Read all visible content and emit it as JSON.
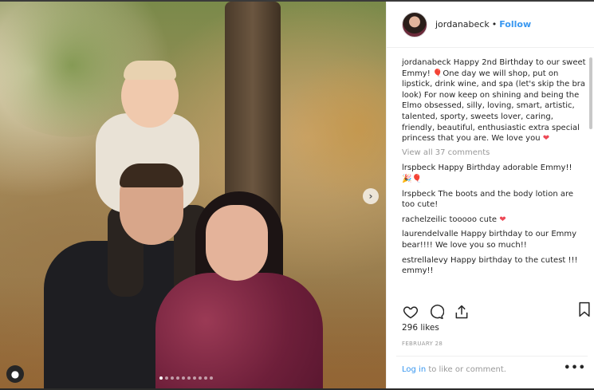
{
  "post": {
    "author": "jordanabeck",
    "follow_label": "Follow",
    "separator": "•"
  },
  "caption": {
    "user": "jordanabeck",
    "text": "Happy 2nd Birthday to our sweet Emmy! ",
    "text2": "One day we will shop, put on lipstick, drink wine, and spa (let's skip the bra look) For now keep on shining and being the Elmo obsessed, silly, loving, smart, artistic, talented, sporty, sweets lover, caring, friendly, beautiful, enthusiastic extra special princess that you are. We love you "
  },
  "view_all_comments": "View all 37 comments",
  "comments": [
    {
      "user": "lrspbeck",
      "text": "Happy Birthday adorable Emmy!!"
    },
    {
      "user": "lrspbeck",
      "text": "The boots and the body lotion are too cute!"
    },
    {
      "user": "rachelzeilic",
      "text": "tooooo cute"
    },
    {
      "user": "laurendelvalle",
      "text": "Happy birthday to our Emmy bear!!!! We love you so much!!"
    },
    {
      "user": "estrellalevy",
      "text": "Happy birthday to the cutest !!! emmy!!"
    }
  ],
  "likes": "296 likes",
  "date": "FEBRUARY 28",
  "login": {
    "link": "Log in",
    "rest": " to like or comment."
  },
  "more_label": "•••",
  "carousel": {
    "count": 10,
    "active_index": 0
  },
  "colors": {
    "link": "#3897f0",
    "text": "#262626",
    "muted": "#999999",
    "heart": "#ed4956"
  },
  "icons": [
    "heart-icon",
    "comment-icon",
    "share-icon",
    "bookmark-icon",
    "user-tag-icon",
    "chevron-right-icon",
    "more-icon"
  ]
}
